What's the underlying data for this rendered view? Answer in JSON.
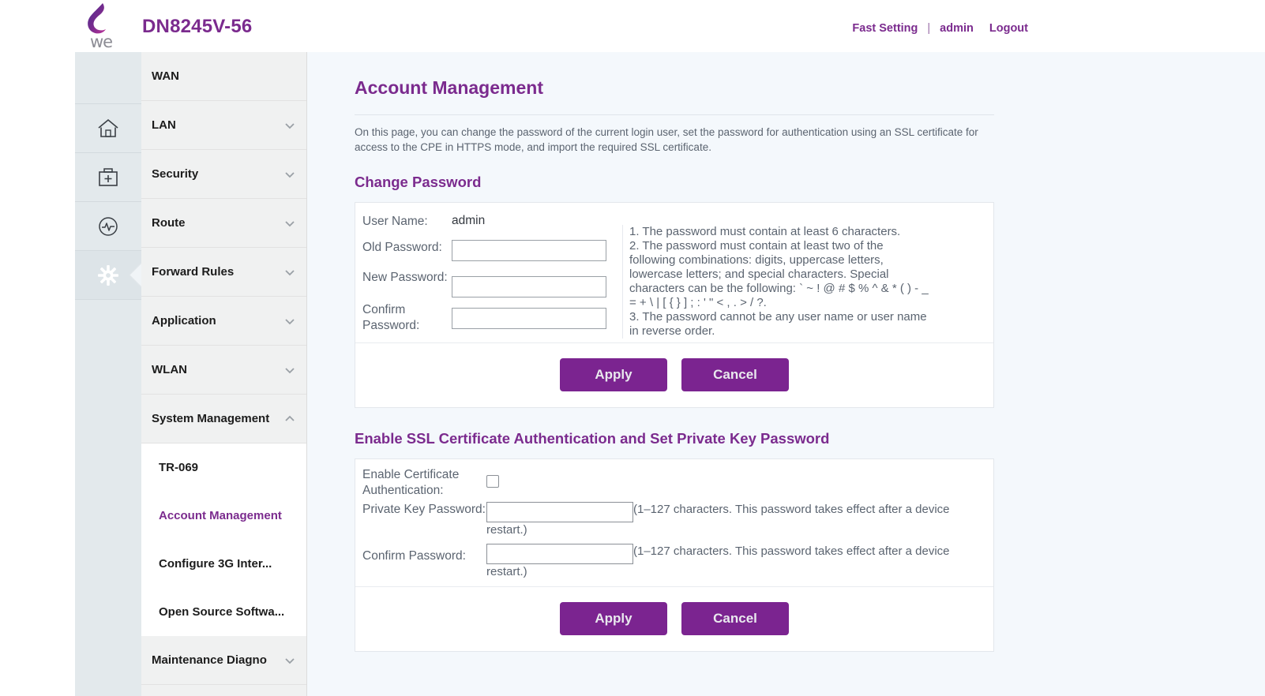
{
  "header": {
    "logo_text": "we",
    "device_title": "DN8245V-56",
    "nav": {
      "fast_setting": "Fast Setting",
      "separator": "|",
      "user": "admin",
      "logout": "Logout"
    },
    "brand_color": "#7b2b8e"
  },
  "icon_rail": {
    "items": [
      {
        "name": "blank-top",
        "icon": ""
      },
      {
        "name": "home-icon",
        "icon": "home"
      },
      {
        "name": "toolkit-icon",
        "icon": "first-aid-kit"
      },
      {
        "name": "diagnostics-icon",
        "icon": "pulse-circle"
      },
      {
        "name": "settings-icon",
        "icon": "gear",
        "active": true
      }
    ]
  },
  "sidebar": {
    "items": [
      {
        "label": "WAN",
        "expandable": false
      },
      {
        "label": "LAN",
        "expandable": true,
        "expanded": false
      },
      {
        "label": "Security",
        "expandable": true,
        "expanded": false
      },
      {
        "label": "Route",
        "expandable": true,
        "expanded": false
      },
      {
        "label": "Forward Rules",
        "expandable": true,
        "expanded": false
      },
      {
        "label": "Application",
        "expandable": true,
        "expanded": false
      },
      {
        "label": "WLAN",
        "expandable": true,
        "expanded": false
      },
      {
        "label": "System Management",
        "expandable": true,
        "expanded": true
      },
      {
        "label": "Maintenance Diagno",
        "expandable": true,
        "expanded": false
      }
    ],
    "submenu": [
      {
        "label": "TR-069",
        "active": false
      },
      {
        "label": "Account Management",
        "active": true
      },
      {
        "label": "Configure 3G Inter...",
        "active": false
      },
      {
        "label": "Open Source Softwa...",
        "active": false
      }
    ]
  },
  "main": {
    "page_title": "Account Management",
    "page_description": "On this page, you can change the password of the current login user, set the password for authentication using an SSL certificate for access to the CPE in HTTPS mode, and import the required SSL certificate.",
    "change_password": {
      "section_title": "Change Password",
      "user_name_label": "User Name:",
      "user_name_value": "admin",
      "old_password_label": "Old Password:",
      "old_password_value": "",
      "new_password_label": "New Password:",
      "new_password_value": "",
      "confirm_password_label": "Confirm Password:",
      "confirm_password_value": "",
      "rules": [
        "1. The password must contain at least 6 characters.",
        "2. The password must contain at least two of the",
        "following combinations: digits, uppercase letters,",
        "lowercase letters; and special characters. Special",
        "characters can be the following: ` ~ ! @ # $ % ^ & * ( ) - _",
        "= + \\ | [ { } ] ; : ' \" < , . > / ?.",
        "3. The password cannot be any user name or user name",
        "in reverse order."
      ],
      "apply_label": "Apply",
      "cancel_label": "Cancel"
    },
    "ssl": {
      "section_title": "Enable SSL Certificate Authentication and Set Private Key Password",
      "enable_cert_label": "Enable Certificate Authentication:",
      "enable_cert_checked": false,
      "private_key_label": "Private Key Password:",
      "private_key_value": "",
      "private_key_hint": "(1–127 characters. This password takes effect after a device restart.)",
      "confirm_password_label": "Confirm Password:",
      "confirm_password_value": "",
      "confirm_password_hint": "(1–127 characters. This password takes effect after a device restart.)",
      "apply_label": "Apply",
      "cancel_label": "Cancel"
    }
  }
}
